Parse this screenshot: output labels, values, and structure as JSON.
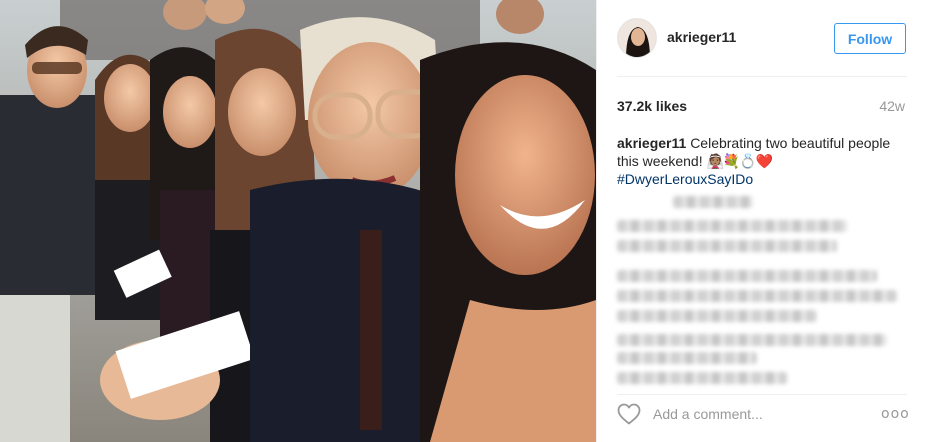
{
  "post": {
    "username": "akrieger11",
    "follow_label": "Follow",
    "likes": "37.2k likes",
    "age": "42w",
    "caption": {
      "author": "akrieger11",
      "text": "Celebrating two beautiful people this weekend!",
      "emoji": "👰🏽💐💍❤️",
      "hashtag": "#DwyerLerouxSayIDo"
    },
    "comment_placeholder": "Add a comment...",
    "more_label": "ooo"
  },
  "icons": {
    "heart": "heart-icon",
    "more": "more-options-icon",
    "avatar": "profile-avatar"
  },
  "colors": {
    "follow": "#3897f0",
    "hashtag": "#003569",
    "muted": "#999999",
    "divider": "#efefef"
  }
}
